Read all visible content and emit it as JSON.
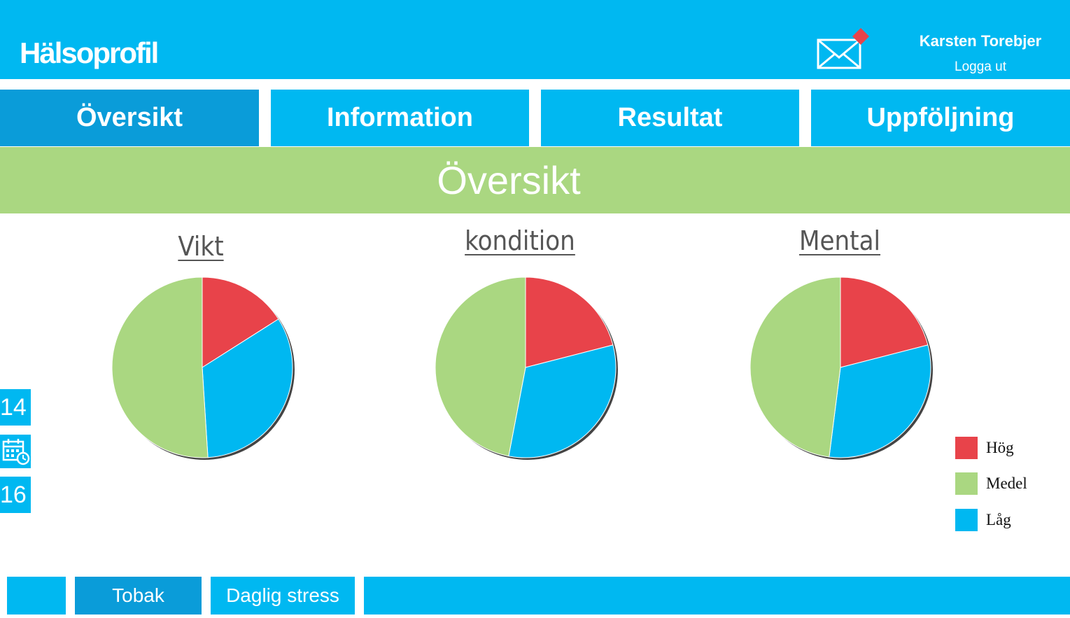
{
  "header": {
    "logo": "Hälsoprofil",
    "user_name": "Karsten Torebjer",
    "logout_label": "Logga ut"
  },
  "nav": {
    "tabs": [
      "Översikt",
      "Information",
      "Resultat",
      "Uppföljning"
    ],
    "active": "Översikt"
  },
  "page": {
    "title": "Översikt"
  },
  "side": {
    "top_number": "14",
    "bottom_number": "16"
  },
  "charts": {
    "titles": [
      "Vikt",
      "kondition",
      "Mental"
    ]
  },
  "colors": {
    "hog": "#e8434a",
    "medel": "#aad781",
    "lag": "#00b8f1",
    "primary": "#00b8f1",
    "active": "#0a9cd9"
  },
  "legend": {
    "items": [
      "Hög",
      "Medel",
      "Låg"
    ]
  },
  "chart_data": [
    {
      "type": "pie",
      "title": "Vikt",
      "categories": [
        "Hög",
        "Låg",
        "Medel"
      ],
      "values": [
        16,
        33,
        51
      ]
    },
    {
      "type": "pie",
      "title": "kondition",
      "categories": [
        "Hög",
        "Låg",
        "Medel"
      ],
      "values": [
        21,
        32,
        47
      ]
    },
    {
      "type": "pie",
      "title": "Mental",
      "categories": [
        "Hög",
        "Låg",
        "Medel"
      ],
      "values": [
        21,
        31,
        48
      ]
    }
  ],
  "bottom": {
    "tabs": [
      "Tobak",
      "Daglig stress"
    ],
    "active": "Tobak"
  }
}
